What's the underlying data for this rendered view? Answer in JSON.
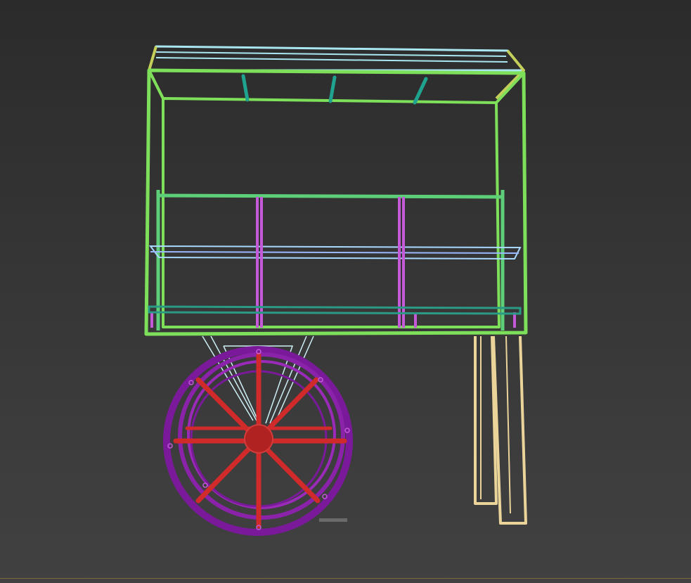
{
  "viewport": {
    "object_name": "cart-wireframe",
    "colors": {
      "frame": "#7ee05a",
      "frame_light": "#9cf06f",
      "roof": "#a9e6f0",
      "roof_dark": "#c4cf5a",
      "braces": "#1fa38f",
      "shelf": "#a8d8ff",
      "shelf_rail": "#2a9a85",
      "posts": "#c45ad8",
      "wheel_rim": "#7a1a9a",
      "wheel_rim_light": "#9a2ab8",
      "spokes": "#d02a2a",
      "legs": "#ead49a",
      "struts": "#cdeff6"
    }
  }
}
